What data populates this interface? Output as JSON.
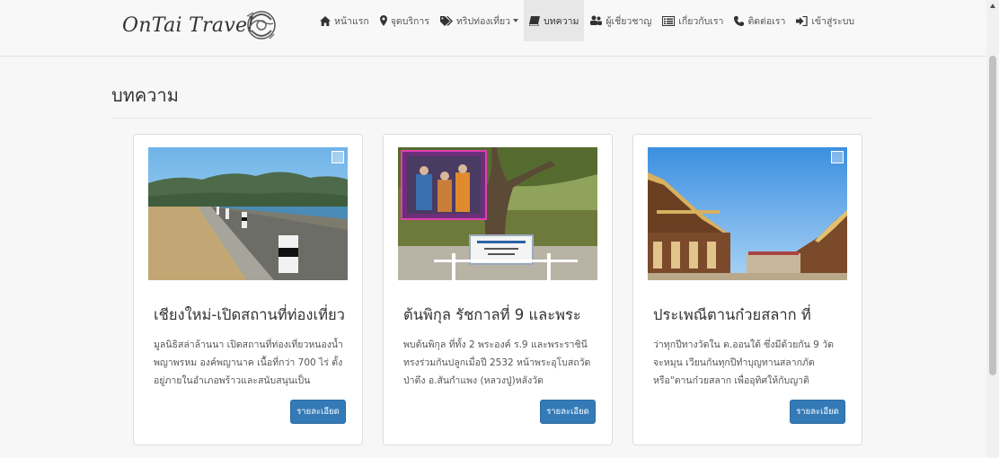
{
  "brand": {
    "name": "OnTai Travel"
  },
  "nav": {
    "items": [
      {
        "label": "หน้าแรก",
        "icon": "home-icon"
      },
      {
        "label": "จุดบริการ",
        "icon": "map-marker-icon"
      },
      {
        "label": "ทริปท่องเที่ยว",
        "icon": "tags-icon",
        "dropdown": true
      },
      {
        "label": "บทความ",
        "icon": "book-icon",
        "active": true
      },
      {
        "label": "ผู้เชี่ยวชาญ",
        "icon": "users-icon"
      },
      {
        "label": "เกี่ยวกับเรา",
        "icon": "list-icon"
      },
      {
        "label": "ติดต่อเรา",
        "icon": "phone-icon"
      },
      {
        "label": "เข้าสู่ระบบ",
        "icon": "sign-in-icon"
      }
    ]
  },
  "page": {
    "title": "บทความ"
  },
  "articles": [
    {
      "title": "เชียงใหม่-เปิดสถานที่ท่องเที่ยว",
      "excerpt": "มูลนิธิสล่าล้านนา เปิดสถานที่ท่องเที่ยวหนองน้ำพญาพรหม องค์พญานาค เนื้อที่กว่า 700 ไร่ ตั้งอยู่ภายในอำเภอพร้าวและสนับสนุนเป็น",
      "button": "รายละเอียด"
    },
    {
      "title": "ต้นพิกุล รัชกาลที่ 9 และพระ",
      "excerpt": "พบต้นพิกุล ที่ทั้ง 2 พระองค์ ร.9 และพระราชินีทรงร่วมกันปลูกเมื่อปี 2532 หน้าพระอุโบสถวัดป่าตึง อ.สันกำแพง (หลวงปู่)หลังวัด",
      "button": "รายละเอียด"
    },
    {
      "title": "ประเพณีตานก๋วยสลาก ที่",
      "excerpt": "ว่าทุกปีทางวัดใน ต.ออนใต้ ซึ่งมีด้วยกัน 9 วัด จะหมุน เวียนกันทุกปีทำบุญทานสลากภัต หรือ\"ตานก๋วยสลาก เพื่ออุทิศให้กับญาติ",
      "button": "รายละเอียด"
    }
  ]
}
